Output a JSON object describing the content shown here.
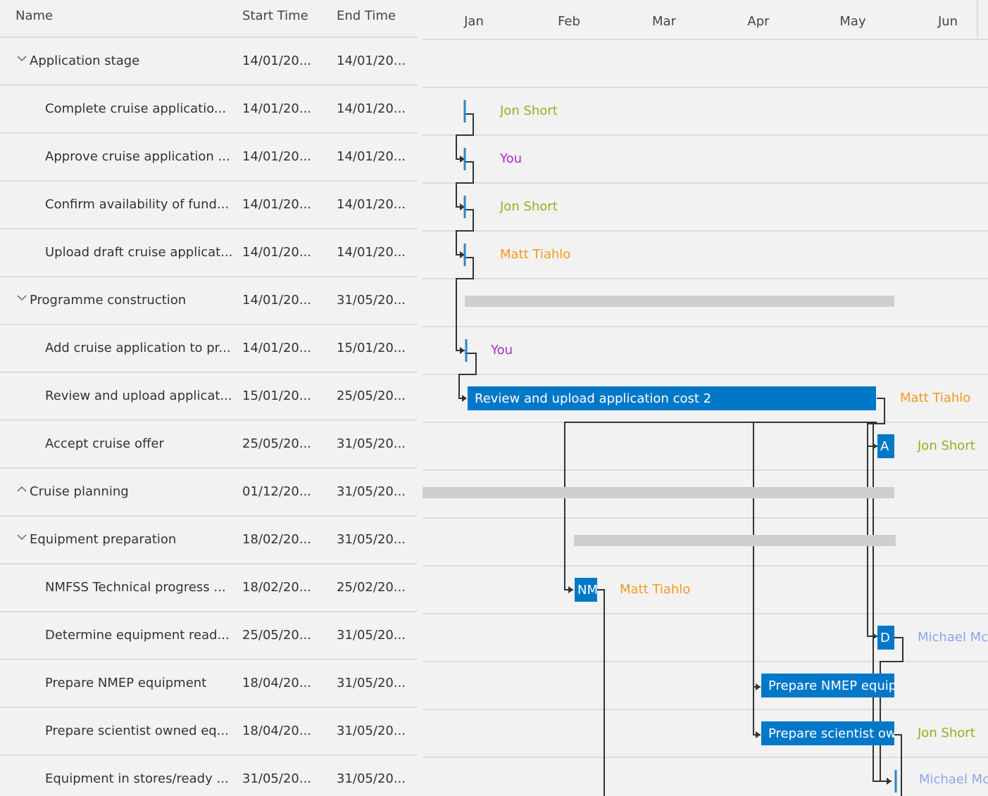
{
  "grid": {
    "columns": {
      "name": "Name",
      "start": "Start Time",
      "end": "End Time"
    }
  },
  "tasks": [
    {
      "name": "Application stage",
      "start": "14/01/20...",
      "end": "14/01/20...",
      "summary": true,
      "expanded": true
    },
    {
      "name": "Complete cruise applicatio...",
      "start": "14/01/20...",
      "end": "14/01/20...",
      "assignee": "Jon Short"
    },
    {
      "name": "Approve cruise application ...",
      "start": "14/01/20...",
      "end": "14/01/20...",
      "assignee": "You"
    },
    {
      "name": "Confirm availability of fund...",
      "start": "14/01/20...",
      "end": "14/01/20...",
      "assignee": "Jon Short"
    },
    {
      "name": "Upload draft cruise applicat...",
      "start": "14/01/20...",
      "end": "14/01/20...",
      "assignee": "Matt Tiahlo"
    },
    {
      "name": "Programme construction",
      "start": "14/01/20...",
      "end": "31/05/20...",
      "summary": true,
      "expanded": true
    },
    {
      "name": "Add cruise application to pr...",
      "start": "14/01/20...",
      "end": "15/01/20...",
      "assignee": "You"
    },
    {
      "name": "Review and upload applicat...",
      "start": "15/01/20...",
      "end": "25/05/20...",
      "assignee": "Matt Tiahlo",
      "bar_label": "Review and upload application cost 2"
    },
    {
      "name": "Accept cruise offer",
      "start": "25/05/20...",
      "end": "31/05/20...",
      "assignee": "Jon Short",
      "bar_label": "A"
    },
    {
      "name": "Cruise planning",
      "start": "01/12/20...",
      "end": "31/05/20...",
      "summary": true,
      "expanded": false
    },
    {
      "name": "Equipment preparation",
      "start": "18/02/20...",
      "end": "31/05/20...",
      "summary": true,
      "expanded": true
    },
    {
      "name": "NMFSS Technical progress ...",
      "start": "18/02/20...",
      "end": "25/02/20...",
      "assignee": "Matt Tiahlo",
      "bar_label": "NM"
    },
    {
      "name": "Determine equipment read...",
      "start": "25/05/20...",
      "end": "31/05/20...",
      "assignee": "Michael McC",
      "bar_label": "D"
    },
    {
      "name": "Prepare NMEP equipment",
      "start": "18/04/20...",
      "end": "31/05/20...",
      "bar_label": "Prepare NMEP equipm"
    },
    {
      "name": "Prepare scientist owned eq...",
      "start": "18/04/20...",
      "end": "31/05/20...",
      "assignee": "Jon Short",
      "bar_label": "Prepare scientist own"
    },
    {
      "name": "Equipment in stores/ready ...",
      "start": "31/05/20...",
      "end": "31/05/20...",
      "assignee": "Michael McC"
    }
  ],
  "timeline": {
    "months": [
      "Jan",
      "Feb",
      "Mar",
      "Apr",
      "May",
      "Jun"
    ]
  },
  "colors": {
    "bar": "#0078c8",
    "summary_bar": "#cfcfcf",
    "milestone": "#2a86c8",
    "connector": "#333333",
    "Jon Short": "#8cb31e",
    "You": "#a030c0",
    "Matt Tiahlo": "#f39a1e",
    "Michael McC": "#8aa6e8"
  }
}
